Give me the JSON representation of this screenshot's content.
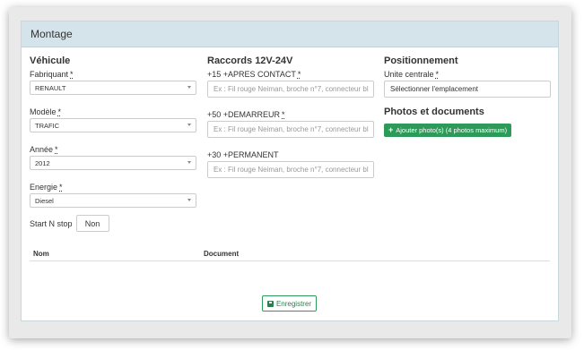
{
  "panel": {
    "title": "Montage"
  },
  "vehicle": {
    "section_title": "Véhicule",
    "fabricant": {
      "label": "Fabriquant",
      "required": "*",
      "value": "RENAULT"
    },
    "modele": {
      "label": "Modèle",
      "required": "*",
      "value": "TRAFIC"
    },
    "annee": {
      "label": "Année",
      "required": "*",
      "value": "2012"
    },
    "energie": {
      "label": "Energie",
      "required": "*",
      "value": "Diesel"
    }
  },
  "raccords": {
    "section_title": "Raccords 12V-24V",
    "apres_contact": {
      "label": "+15 +APRES CONTACT",
      "required": "*",
      "placeholder": "Ex : Fil rouge Neiman, broche n°7, connecteur bl"
    },
    "demarreur": {
      "label": "+50 +DEMARREUR",
      "required": "*",
      "placeholder": "Ex : Fil rouge Neiman, broche n°7, connecteur bl"
    },
    "permanent": {
      "label": "+30 +PERMANENT",
      "placeholder": "Ex : Fil rouge Neiman, broche n°7, connecteur bl"
    }
  },
  "positionnement": {
    "section_title": "Positionnement",
    "unite_centrale": {
      "label": "Unite centrale",
      "required": "*",
      "value": "Sélectionner l'emplacement"
    }
  },
  "photos": {
    "section_title": "Photos et documents",
    "add_button": "Ajouter photo(s) (4 photos maximum)"
  },
  "start_stop": {
    "label": "Start N stop",
    "value": "Non"
  },
  "table": {
    "columns": [
      "Nom",
      "Document"
    ]
  },
  "save_button": "Enregistrer"
}
